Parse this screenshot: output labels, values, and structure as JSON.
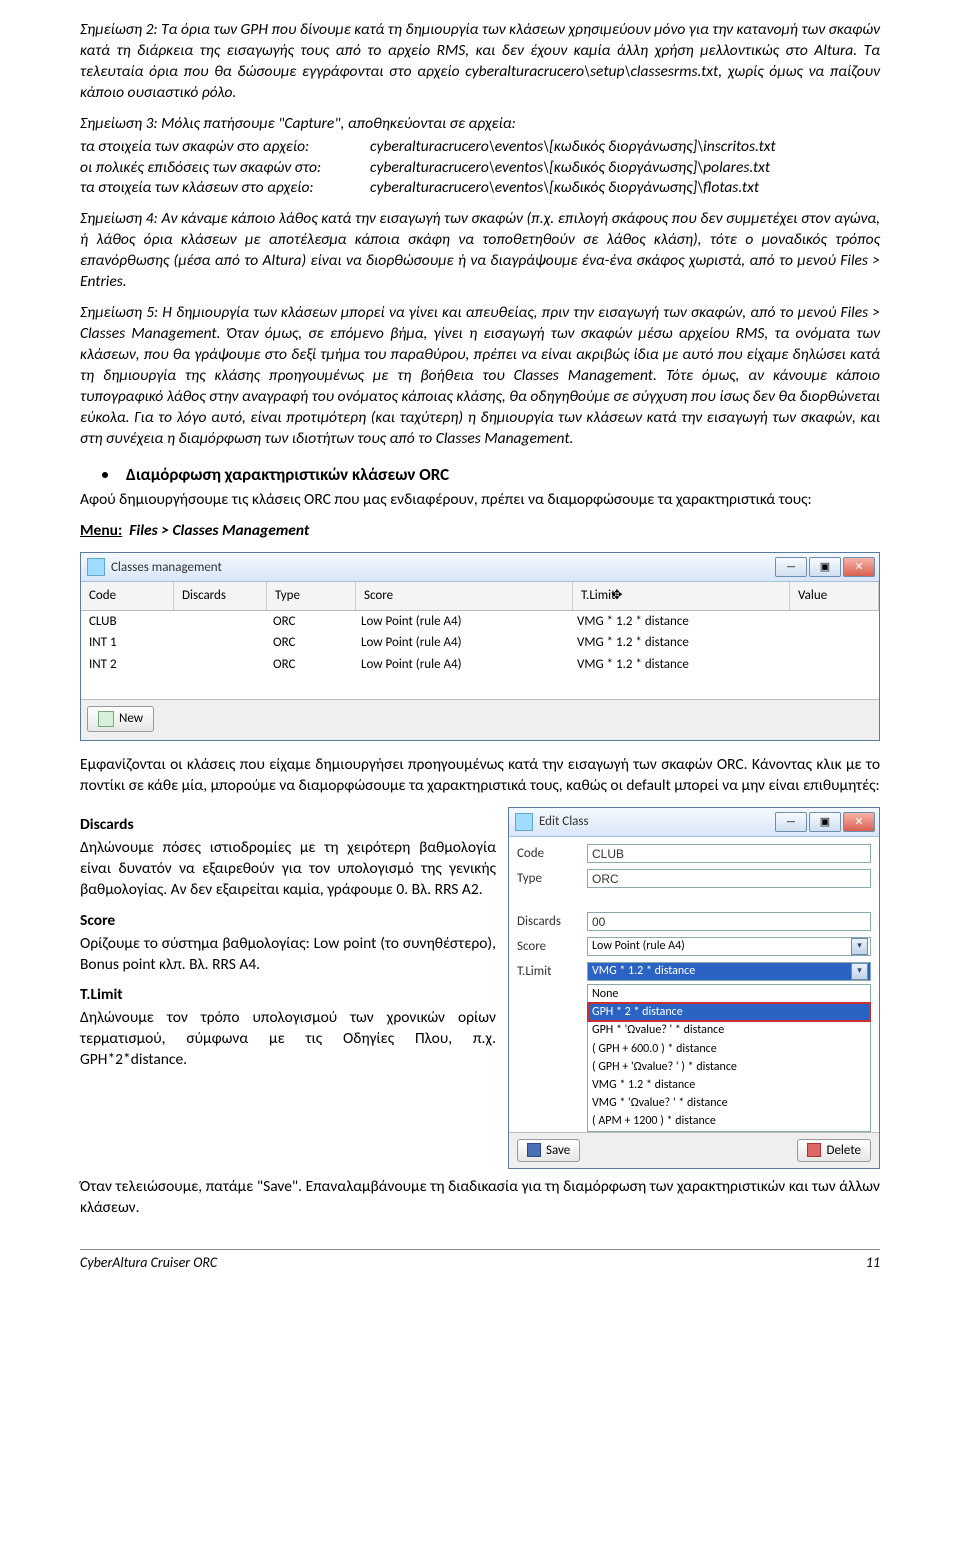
{
  "p1": "Σημείωση 2: Τα όρια των GPH που δίνουμε κατά τη δημιουργία των κλάσεων χρησιμεύουν μόνο για την κατανομή των σκαφών κατά τη διάρκεια της εισαγωγής τους από το αρχείο RMS, και δεν έχουν καμία άλλη χρήση μελλοντικώς στο Altura. Τα τελευταία όρια που θα δώσουμε εγγράφονται στο αρχείο cyberalturacrucero\\setup\\classesrms.txt, χωρίς όμως να παίζουν κάποιο ουσιαστικό ρόλο.",
  "p2_intro": "Σημείωση 3: Μόλις πατήσουμε \"Capture\", αποθηκεύονται σε αρχεία:",
  "p2_rows": [
    {
      "a": "τα στοιχεία των σκαφών στο αρχείο:",
      "b": "cyberalturacrucero\\eventos\\[κωδικός διοργάνωσης]\\inscritos.txt"
    },
    {
      "a": "οι πολικές επιδόσεις των σκαφών στο:",
      "b": "cyberalturacrucero\\eventos\\[κωδικός διοργάνωσης]\\polares.txt"
    },
    {
      "a": "τα στοιχεία των κλάσεων στο αρχείο:",
      "b": "cyberalturacrucero\\eventos\\[κωδικός διοργάνωσης]\\flotas.txt"
    }
  ],
  "p3": "Σημείωση 4: Αν κάναμε κάποιο λάθος κατά την εισαγωγή των σκαφών (π.χ. επιλογή σκάφους που δεν συμμετέχει στον αγώνα, ή λάθος όρια κλάσεων με αποτέλεσμα κάποια σκάφη να τοποθετηθούν σε λάθος κλάση), τότε ο μοναδικός τρόπος επανόρθωσης (μέσα από το Altura) είναι να διορθώσουμε ή να διαγράψουμε ένα-ένα σκάφος χωριστά, από το μενού Files > Entries.",
  "p4": "Σημείωση 5: Η δημιουργία των κλάσεων μπορεί να γίνει και απευθείας, πριν την εισαγωγή των σκαφών, από το μενού Files > Classes Management. Όταν όμως, σε επόμενο βήμα, γίνει η εισαγωγή των σκαφών μέσω αρχείου RMS, τα ονόματα των κλάσεων, που θα γράψουμε στο δεξί τμήμα του παραθύρου, πρέπει να είναι ακριβώς ίδια με αυτό που είχαμε δηλώσει κατά τη δημιουργία της κλάσης προηγουμένως με τη βοήθεια του Classes Management. Τότε όμως, αν κάνουμε κάποιο τυπογραφικό λάθος στην αναγραφή του ονόματος κάποιας κλάσης, θα οδηγηθούμε σε σύγχυση που ίσως δεν θα διορθώνεται εύκολα. Για το λόγο αυτό, είναι προτιμότερη (και ταχύτερη) η δημιουργία των κλάσεων κατά την εισαγωγή των σκαφών, και στη συνέχεια η διαμόρφωση των ιδιοτήτων τους από το Classes Management.",
  "bul1": "Διαμόρφωση χαρακτηριστικών κλάσεων ORC",
  "p5": "Αφού δημιουργήσουμε τις κλάσεις ORC που μας ενδιαφέρουν, πρέπει να διαμορφώσουμε τα χαρακτηριστικά τους:",
  "menu_label": "Menu:",
  "menu_path": "Files > Classes Management",
  "cm_title": "Classes management",
  "cm_cols": {
    "code": "Code",
    "disc": "Discards",
    "type": "Type",
    "score": "Score",
    "tlim": "T.Limit",
    "val": "Value"
  },
  "cm_rows": [
    {
      "code": "CLUB",
      "type": "ORC",
      "score": "Low Point (rule A4)",
      "tlim": "VMG * 1.2 * distance"
    },
    {
      "code": "INT 1",
      "type": "ORC",
      "score": "Low Point (rule A4)",
      "tlim": "VMG * 1.2 * distance"
    },
    {
      "code": "INT 2",
      "type": "ORC",
      "score": "Low Point (rule A4)",
      "tlim": "VMG * 1.2 * distance"
    }
  ],
  "cm_new": "New",
  "p6": "Εμφανίζονται οι κλάσεις που είχαμε δημιουργήσει προηγουμένως κατά την εισαγωγή των σκαφών ORC. Κάνοντας κλικ με το ποντίκι σε κάθε μία, μπορούμε να διαμορφώσουμε τα χαρακτηριστικά τους, καθώς οι default μπορεί να μην είναι επιθυμητές:",
  "d_label": "Discards",
  "d_text": "Δηλώνουμε πόσες ιστιοδρομίες με τη χειρότερη βαθμολογία είναι δυνατόν να εξαιρεθούν για τον υπολογισμό της γενικής βαθμολογίας. Αν δεν εξαιρείται καμία, γράφουμε 0. Βλ. RRS A2.",
  "s_label": "Score",
  "s_text": "Ορίζουμε το σύστημα βαθμολογίας: Low point (το συνηθέστερο), Bonus point κλπ. Βλ. RRS A4.",
  "t_label": "T.Limit",
  "t_text": "Δηλώνουμε τον τρόπο υπολογισμού των χρονικών ορίων τερματισμού, σύμφωνα με τις Οδηγίες Πλου, π.χ. GPH*2*distance.",
  "ec_title": "Edit Class",
  "ec_labels": {
    "code": "Code",
    "type": "Type",
    "disc": "Discards",
    "score": "Score",
    "tlim": "T.Limit"
  },
  "ec_vals": {
    "code": "CLUB",
    "type": "ORC",
    "disc": "00",
    "score": "Low Point (rule A4)",
    "tlim": "VMG * 1.2 * distance"
  },
  "ec_opts": [
    "None",
    "GPH * 2 * distance",
    "GPH * 'Ωvalue? ' * distance",
    "( GPH + 600.0 ) * distance",
    "( GPH + 'Ωvalue? ' ) * distance",
    "VMG * 1.2 * distance",
    "VMG * 'Ωvalue? ' * distance",
    "( APM + 1200 ) * distance"
  ],
  "ec_save": "Save",
  "ec_delete": "Delete",
  "p7": "Όταν τελειώσουμε, πατάμε \"Save\". Επαναλαμβάνουμε τη διαδικασία για τη διαμόρφωση των χαρακτηριστικών και των άλλων κλάσεων.",
  "footer_left": "CyberAltura Cruiser ORC",
  "footer_right": "11"
}
